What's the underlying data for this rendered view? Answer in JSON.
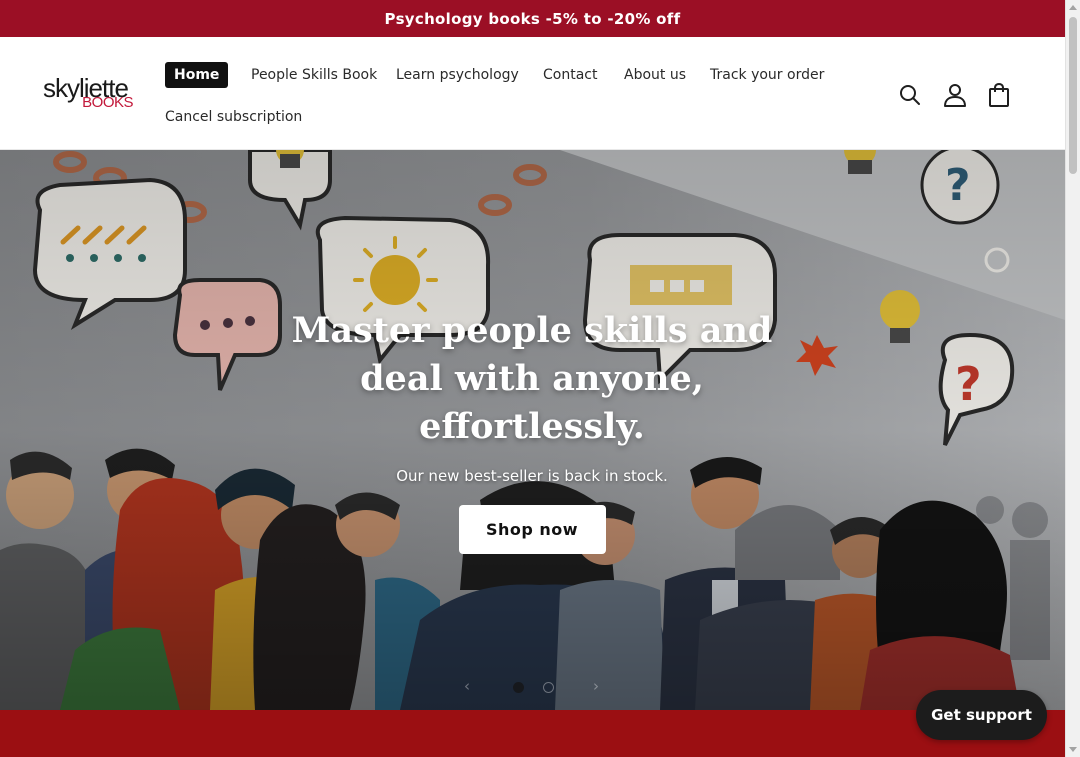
{
  "announcement": {
    "text": "Psychology books -5% to -20% off"
  },
  "logo": {
    "main": "skyliette",
    "sub": "BOOKS"
  },
  "nav": {
    "items": [
      {
        "label": "Home",
        "active": true
      },
      {
        "label": "People Skills Book",
        "active": false
      },
      {
        "label": "Learn psychology",
        "active": false
      },
      {
        "label": "Contact",
        "active": false
      },
      {
        "label": "About us",
        "active": false
      },
      {
        "label": "Track your order",
        "active": false
      },
      {
        "label": "Cancel subscription",
        "active": false
      }
    ]
  },
  "header_icons": [
    "search-icon",
    "account-icon",
    "cart-icon"
  ],
  "hero": {
    "title": "Master people skills and deal with anyone, effortlessly.",
    "subtitle": "Our new best-seller is back in stock.",
    "cta": "Shop now",
    "slides_total": 2,
    "slide_active": 1
  },
  "support": {
    "label": "Get support"
  },
  "colors": {
    "brand_red": "#9b0f25",
    "logo_accent": "#c2183a",
    "strip_red": "#9b0f12",
    "dark": "#111111"
  }
}
